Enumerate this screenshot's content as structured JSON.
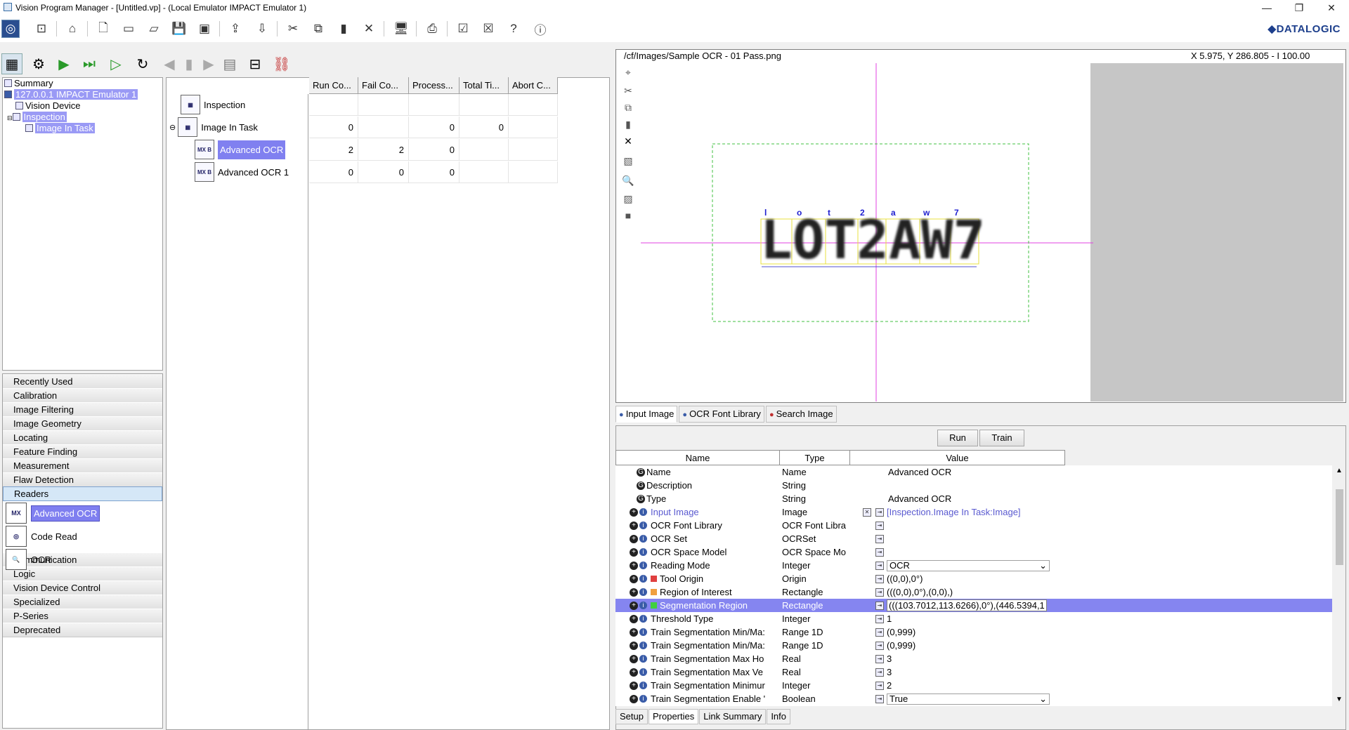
{
  "window": {
    "title": "Vision Program Manager - [Untitled.vp] - (Local Emulator IMPACT Emulator 1)",
    "min": "—",
    "max": "❐",
    "close": "✕"
  },
  "brand": "◆DATALOGIC",
  "nav_tree": {
    "summary": "Summary",
    "device": "127.0.0.1 IMPACT Emulator 1",
    "vision_device": "Vision Device",
    "inspection": "Inspection",
    "image_in_task": "Image In Task"
  },
  "categories": [
    "Recently Used",
    "Calibration",
    "Image Filtering",
    "Image Geometry",
    "Locating",
    "Feature Finding",
    "Measurement",
    "Flaw Detection",
    "Readers",
    "Communication",
    "Logic",
    "Vision Device Control",
    "Specialized",
    "P-Series",
    "Deprecated"
  ],
  "reader_tools": [
    "Advanced OCR",
    "Code Read",
    "OCR"
  ],
  "center": {
    "columns": [
      "Run Co...",
      "Fail Co...",
      "Process...",
      "Total Ti...",
      "Abort C..."
    ],
    "nodes": [
      {
        "label": "Inspection",
        "values": [
          "",
          "",
          "",
          "",
          ""
        ]
      },
      {
        "label": "Image In Task",
        "values": [
          "0",
          "",
          "0",
          "0",
          ""
        ]
      },
      {
        "label": "Advanced OCR",
        "values": [
          "2",
          "2",
          "0",
          "",
          ""
        ]
      },
      {
        "label": "Advanced OCR 1",
        "values": [
          "0",
          "0",
          "0",
          "",
          ""
        ]
      }
    ]
  },
  "image_view": {
    "path": "/cf/Images/Sample OCR - 01 Pass.png",
    "coords": "X 5.975,  Y 286.805  -  I 100.00",
    "ocr_text": "LOT2AW7",
    "ocr_labels": [
      "l",
      "o",
      "t",
      "2",
      "a",
      "w",
      "7"
    ]
  },
  "image_tabs": [
    "Input Image",
    "OCR Font Library",
    "Search Image"
  ],
  "buttons": {
    "run": "Run",
    "train": "Train"
  },
  "props": {
    "headers": [
      "Name",
      "Type",
      "Value"
    ],
    "rows": [
      {
        "name": "Name",
        "type": "Name",
        "value": "Advanced OCR",
        "kind": "g"
      },
      {
        "name": "Description",
        "type": "String",
        "value": "",
        "kind": "g"
      },
      {
        "name": "Type",
        "type": "String",
        "value": "Advanced OCR",
        "kind": "g"
      },
      {
        "name": "Input Image",
        "type": "Image",
        "value": "[Inspection.Image In Task:Image]",
        "kind": "input"
      },
      {
        "name": "OCR Font Library",
        "type": "OCR Font Libra",
        "value": "",
        "kind": "p"
      },
      {
        "name": "OCR Set",
        "type": "OCRSet",
        "value": "",
        "kind": "q"
      },
      {
        "name": "OCR Space Model",
        "type": "OCR Space Mo",
        "value": "",
        "kind": "p"
      },
      {
        "name": "Reading Mode",
        "type": "Integer",
        "value": "OCR",
        "kind": "combo"
      },
      {
        "name": "Tool Origin",
        "type": "Origin",
        "value": "((0,0),0°)",
        "kind": "red"
      },
      {
        "name": "Region of Interest",
        "type": "Rectangle",
        "value": "(((0,0),0°),(0,0),)",
        "kind": "orange"
      },
      {
        "name": "Segmentation Region",
        "type": "Rectangle",
        "value": "(((103.7012,113.6266),0°),(446.5394,1",
        "kind": "green"
      },
      {
        "name": "Threshold Type",
        "type": "Integer",
        "value": "1",
        "kind": "p"
      },
      {
        "name": "Train Segmentation Min/Ma:",
        "type": "Range 1D",
        "value": "(0,999)",
        "kind": "p"
      },
      {
        "name": "Train Segmentation Min/Ma:",
        "type": "Range 1D",
        "value": "(0,999)",
        "kind": "p"
      },
      {
        "name": "Train Segmentation Max Ho",
        "type": "Real",
        "value": "3",
        "kind": "p"
      },
      {
        "name": "Train Segmentation Max Ve",
        "type": "Real",
        "value": "3",
        "kind": "p"
      },
      {
        "name": "Train Segmentation Minimur",
        "type": "Integer",
        "value": "2",
        "kind": "p"
      },
      {
        "name": "Train Segmentation Enable '",
        "type": "Boolean",
        "value": "True",
        "kind": "combo"
      }
    ]
  },
  "bottom_tabs": [
    "Setup",
    "Properties",
    "Link Summary",
    "Info"
  ]
}
